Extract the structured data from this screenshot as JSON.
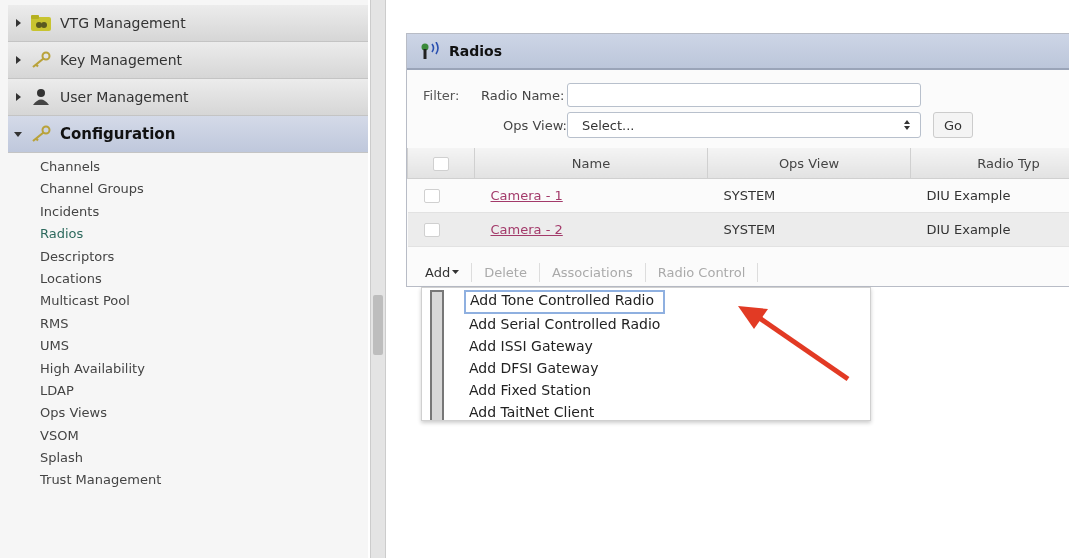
{
  "sidebar": {
    "sections": [
      {
        "label": "VTG Management",
        "kind": "vtg",
        "expanded": false
      },
      {
        "label": "Key Management",
        "kind": "key",
        "expanded": false
      },
      {
        "label": "User Management",
        "kind": "user",
        "expanded": false
      },
      {
        "label": "Configuration",
        "kind": "key",
        "expanded": true,
        "children": [
          {
            "label": "Channels",
            "selected": false
          },
          {
            "label": "Channel Groups",
            "selected": false
          },
          {
            "label": "Incidents",
            "selected": false
          },
          {
            "label": "Radios",
            "selected": true
          },
          {
            "label": "Descriptors",
            "selected": false
          },
          {
            "label": "Locations",
            "selected": false
          },
          {
            "label": "Multicast Pool",
            "selected": false
          },
          {
            "label": "RMS",
            "selected": false
          },
          {
            "label": "UMS",
            "selected": false
          },
          {
            "label": "High Availability",
            "selected": false
          },
          {
            "label": "LDAP",
            "selected": false
          },
          {
            "label": "Ops Views",
            "selected": false
          },
          {
            "label": "VSOM",
            "selected": false
          },
          {
            "label": "Splash",
            "selected": false
          },
          {
            "label": "Trust Management",
            "selected": false
          }
        ]
      }
    ]
  },
  "panel": {
    "title": "Radios",
    "filter": {
      "label": "Filter:",
      "name_label": "Radio Name:",
      "ops_label": "Ops View:",
      "ops_value": "Select...",
      "go": "Go"
    },
    "table": {
      "select_all_checked": false,
      "columns": [
        "Name",
        "Ops View",
        "Radio Typ"
      ],
      "rows": [
        {
          "checked": false,
          "cells": [
            "Camera - 1",
            "SYSTEM",
            "DIU Example"
          ]
        },
        {
          "checked": false,
          "cells": [
            "Camera - 2",
            "SYSTEM",
            "DIU Example"
          ]
        }
      ]
    },
    "toolbar": [
      {
        "label": "Add",
        "disabled": false,
        "dropdown": true
      },
      {
        "label": "Delete",
        "disabled": true,
        "dropdown": false
      },
      {
        "label": "Associations",
        "disabled": true,
        "dropdown": false
      },
      {
        "label": "Radio Control",
        "disabled": true,
        "dropdown": false
      }
    ],
    "add_menu": [
      {
        "label": "Add Tone Controlled Radio",
        "selected": true
      },
      {
        "label": "Add Serial Controlled Radio",
        "selected": false
      },
      {
        "label": "Add ISSI Gateway",
        "selected": false
      },
      {
        "label": "Add DFSI Gateway",
        "selected": false
      },
      {
        "label": "Add Fixed Station",
        "selected": false
      },
      {
        "label": "Add TaitNet Client",
        "selected": false
      }
    ]
  }
}
